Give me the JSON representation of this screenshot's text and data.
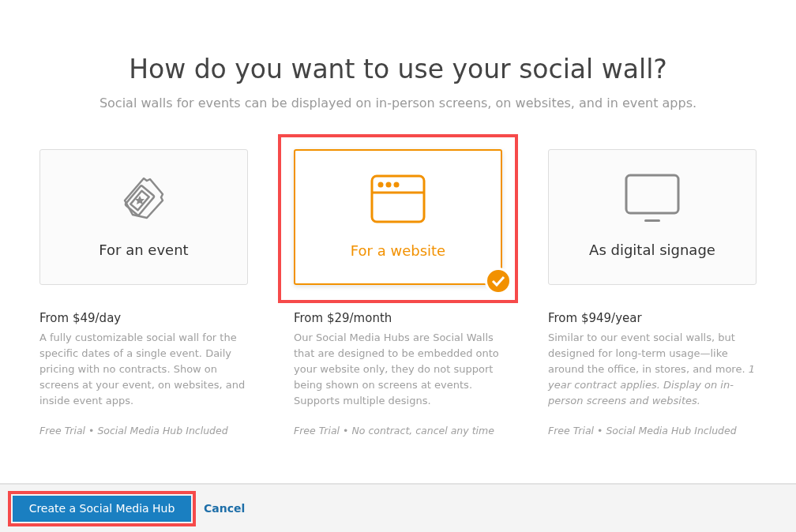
{
  "heading": "How do you want to use your social wall?",
  "subheading": "Social walls for events can be displayed on in-person screens, on websites, and in event apps.",
  "options": [
    {
      "kind": "tickets",
      "label": "For an event",
      "selected": false,
      "highlighted": false,
      "price": "From $49/day",
      "description": "A fully customizable social wall for the specific dates of a single event. Daily pricing with no contracts. Show on screens at your event, on websites, and inside event apps.",
      "note": "Free Trial • Social Media Hub Included"
    },
    {
      "kind": "browser",
      "label": "For a website",
      "selected": true,
      "highlighted": true,
      "price": "From $29/month",
      "description": "Our Social Media Hubs are Social Walls that are designed to be embedded onto your website only, they do not support being shown on screens at events. Supports multiple designs.",
      "note": "Free Trial • No contract, cancel any time"
    },
    {
      "kind": "monitor",
      "label": "As digital signage",
      "selected": false,
      "highlighted": false,
      "price": "From $949/year",
      "description": "Similar to our event social walls, but designed for long-term usage—like around the office, in stores, and more. *1 year contract applies. Display on in-person screens and websites.*",
      "note": "Free Trial • Social Media Hub Included"
    }
  ],
  "footer": {
    "primary_button": {
      "label": "Create a Social Media Hub",
      "highlighted": true
    },
    "cancel_link": "Cancel"
  }
}
